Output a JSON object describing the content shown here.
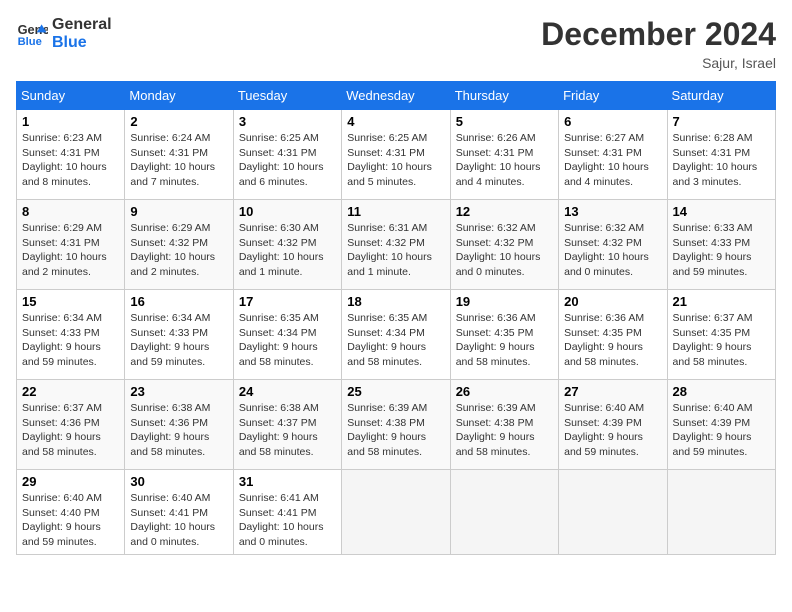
{
  "header": {
    "logo_line1": "General",
    "logo_line2": "Blue",
    "title": "December 2024",
    "location": "Sajur, Israel"
  },
  "days_of_week": [
    "Sunday",
    "Monday",
    "Tuesday",
    "Wednesday",
    "Thursday",
    "Friday",
    "Saturday"
  ],
  "weeks": [
    [
      {
        "day": "1",
        "sunrise": "6:23 AM",
        "sunset": "4:31 PM",
        "daylight": "10 hours and 8 minutes."
      },
      {
        "day": "2",
        "sunrise": "6:24 AM",
        "sunset": "4:31 PM",
        "daylight": "10 hours and 7 minutes."
      },
      {
        "day": "3",
        "sunrise": "6:25 AM",
        "sunset": "4:31 PM",
        "daylight": "10 hours and 6 minutes."
      },
      {
        "day": "4",
        "sunrise": "6:25 AM",
        "sunset": "4:31 PM",
        "daylight": "10 hours and 5 minutes."
      },
      {
        "day": "5",
        "sunrise": "6:26 AM",
        "sunset": "4:31 PM",
        "daylight": "10 hours and 4 minutes."
      },
      {
        "day": "6",
        "sunrise": "6:27 AM",
        "sunset": "4:31 PM",
        "daylight": "10 hours and 4 minutes."
      },
      {
        "day": "7",
        "sunrise": "6:28 AM",
        "sunset": "4:31 PM",
        "daylight": "10 hours and 3 minutes."
      }
    ],
    [
      {
        "day": "8",
        "sunrise": "6:29 AM",
        "sunset": "4:31 PM",
        "daylight": "10 hours and 2 minutes."
      },
      {
        "day": "9",
        "sunrise": "6:29 AM",
        "sunset": "4:32 PM",
        "daylight": "10 hours and 2 minutes."
      },
      {
        "day": "10",
        "sunrise": "6:30 AM",
        "sunset": "4:32 PM",
        "daylight": "10 hours and 1 minute."
      },
      {
        "day": "11",
        "sunrise": "6:31 AM",
        "sunset": "4:32 PM",
        "daylight": "10 hours and 1 minute."
      },
      {
        "day": "12",
        "sunrise": "6:32 AM",
        "sunset": "4:32 PM",
        "daylight": "10 hours and 0 minutes."
      },
      {
        "day": "13",
        "sunrise": "6:32 AM",
        "sunset": "4:32 PM",
        "daylight": "10 hours and 0 minutes."
      },
      {
        "day": "14",
        "sunrise": "6:33 AM",
        "sunset": "4:33 PM",
        "daylight": "9 hours and 59 minutes."
      }
    ],
    [
      {
        "day": "15",
        "sunrise": "6:34 AM",
        "sunset": "4:33 PM",
        "daylight": "9 hours and 59 minutes."
      },
      {
        "day": "16",
        "sunrise": "6:34 AM",
        "sunset": "4:33 PM",
        "daylight": "9 hours and 59 minutes."
      },
      {
        "day": "17",
        "sunrise": "6:35 AM",
        "sunset": "4:34 PM",
        "daylight": "9 hours and 58 minutes."
      },
      {
        "day": "18",
        "sunrise": "6:35 AM",
        "sunset": "4:34 PM",
        "daylight": "9 hours and 58 minutes."
      },
      {
        "day": "19",
        "sunrise": "6:36 AM",
        "sunset": "4:35 PM",
        "daylight": "9 hours and 58 minutes."
      },
      {
        "day": "20",
        "sunrise": "6:36 AM",
        "sunset": "4:35 PM",
        "daylight": "9 hours and 58 minutes."
      },
      {
        "day": "21",
        "sunrise": "6:37 AM",
        "sunset": "4:35 PM",
        "daylight": "9 hours and 58 minutes."
      }
    ],
    [
      {
        "day": "22",
        "sunrise": "6:37 AM",
        "sunset": "4:36 PM",
        "daylight": "9 hours and 58 minutes."
      },
      {
        "day": "23",
        "sunrise": "6:38 AM",
        "sunset": "4:36 PM",
        "daylight": "9 hours and 58 minutes."
      },
      {
        "day": "24",
        "sunrise": "6:38 AM",
        "sunset": "4:37 PM",
        "daylight": "9 hours and 58 minutes."
      },
      {
        "day": "25",
        "sunrise": "6:39 AM",
        "sunset": "4:38 PM",
        "daylight": "9 hours and 58 minutes."
      },
      {
        "day": "26",
        "sunrise": "6:39 AM",
        "sunset": "4:38 PM",
        "daylight": "9 hours and 58 minutes."
      },
      {
        "day": "27",
        "sunrise": "6:40 AM",
        "sunset": "4:39 PM",
        "daylight": "9 hours and 59 minutes."
      },
      {
        "day": "28",
        "sunrise": "6:40 AM",
        "sunset": "4:39 PM",
        "daylight": "9 hours and 59 minutes."
      }
    ],
    [
      {
        "day": "29",
        "sunrise": "6:40 AM",
        "sunset": "4:40 PM",
        "daylight": "9 hours and 59 minutes."
      },
      {
        "day": "30",
        "sunrise": "6:40 AM",
        "sunset": "4:41 PM",
        "daylight": "10 hours and 0 minutes."
      },
      {
        "day": "31",
        "sunrise": "6:41 AM",
        "sunset": "4:41 PM",
        "daylight": "10 hours and 0 minutes."
      },
      null,
      null,
      null,
      null
    ]
  ],
  "labels": {
    "sunrise": "Sunrise:",
    "sunset": "Sunset:",
    "daylight": "Daylight:"
  }
}
